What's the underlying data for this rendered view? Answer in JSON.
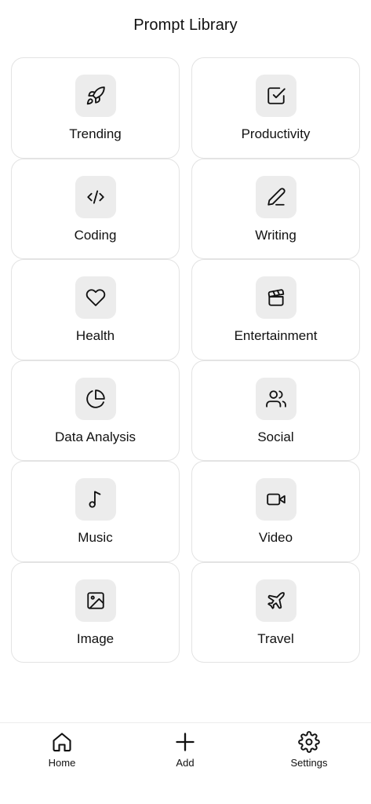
{
  "header": {
    "title": "Prompt Library"
  },
  "categories": [
    {
      "label": "Trending",
      "icon": "rocket-icon"
    },
    {
      "label": "Productivity",
      "icon": "checkbox-icon"
    },
    {
      "label": "Coding",
      "icon": "code-icon"
    },
    {
      "label": "Writing",
      "icon": "pen-icon"
    },
    {
      "label": "Health",
      "icon": "heart-icon"
    },
    {
      "label": "Entertainment",
      "icon": "clapperboard-icon"
    },
    {
      "label": "Data Analysis",
      "icon": "pie-chart-icon"
    },
    {
      "label": "Social",
      "icon": "users-icon"
    },
    {
      "label": "Music",
      "icon": "music-note-icon"
    },
    {
      "label": "Video",
      "icon": "video-camera-icon"
    },
    {
      "label": "Image",
      "icon": "image-icon"
    },
    {
      "label": "Travel",
      "icon": "plane-icon"
    }
  ],
  "tabbar": {
    "home_label": "Home",
    "add_label": "Add",
    "settings_label": "Settings"
  },
  "colors": {
    "icon_bg": "#ececec",
    "card_border": "#e3e3e3",
    "text": "#111111"
  }
}
